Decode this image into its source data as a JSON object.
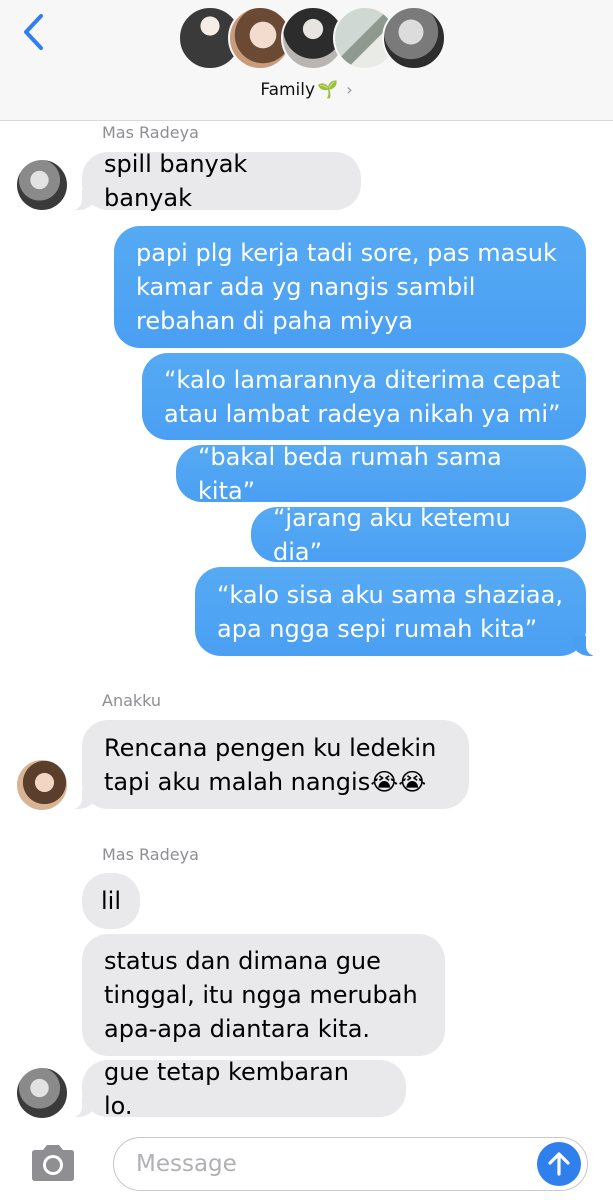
{
  "header": {
    "group_name": "Family",
    "group_emoji": "🌱",
    "chevron": "›",
    "icons": {
      "back": "chevron-left-icon"
    }
  },
  "thread": [
    {
      "sender": "Mas Radeya",
      "direction": "incoming",
      "text": "spill banyak banyak"
    },
    {
      "direction": "outgoing",
      "text": "papi plg kerja tadi sore, pas masuk\nkamar ada yg nangis sambil\nrebahan di paha miyya"
    },
    {
      "direction": "outgoing",
      "text": "“kalo lamarannya diterima cepat\natau lambat radeya nikah ya mi”"
    },
    {
      "direction": "outgoing",
      "text": "“bakal beda rumah sama kita”"
    },
    {
      "direction": "outgoing",
      "text": "“jarang aku ketemu dia”"
    },
    {
      "direction": "outgoing",
      "text": "“kalo sisa aku sama shaziaa,\napa ngga sepi rumah kita”"
    },
    {
      "sender": "Anakku",
      "direction": "incoming",
      "text": "Rencana pengen ku ledekin\ntapi aku malah nangis😭😭"
    },
    {
      "sender": "Mas Radeya",
      "direction": "incoming",
      "text": "lil"
    },
    {
      "direction": "incoming",
      "text": "status dan dimana gue\ntinggal, itu ngga merubah\napa-apa diantara kita."
    },
    {
      "direction": "incoming",
      "text": "gue tetap kembaran lo."
    }
  ],
  "composer": {
    "placeholder": "Message",
    "icons": {
      "camera": "camera-icon",
      "send": "send-arrow-up-icon"
    }
  },
  "colors": {
    "outgoing_bubble": "#4a9ff3",
    "incoming_bubble": "#e9e9eb",
    "accent": "#2f80ed"
  }
}
